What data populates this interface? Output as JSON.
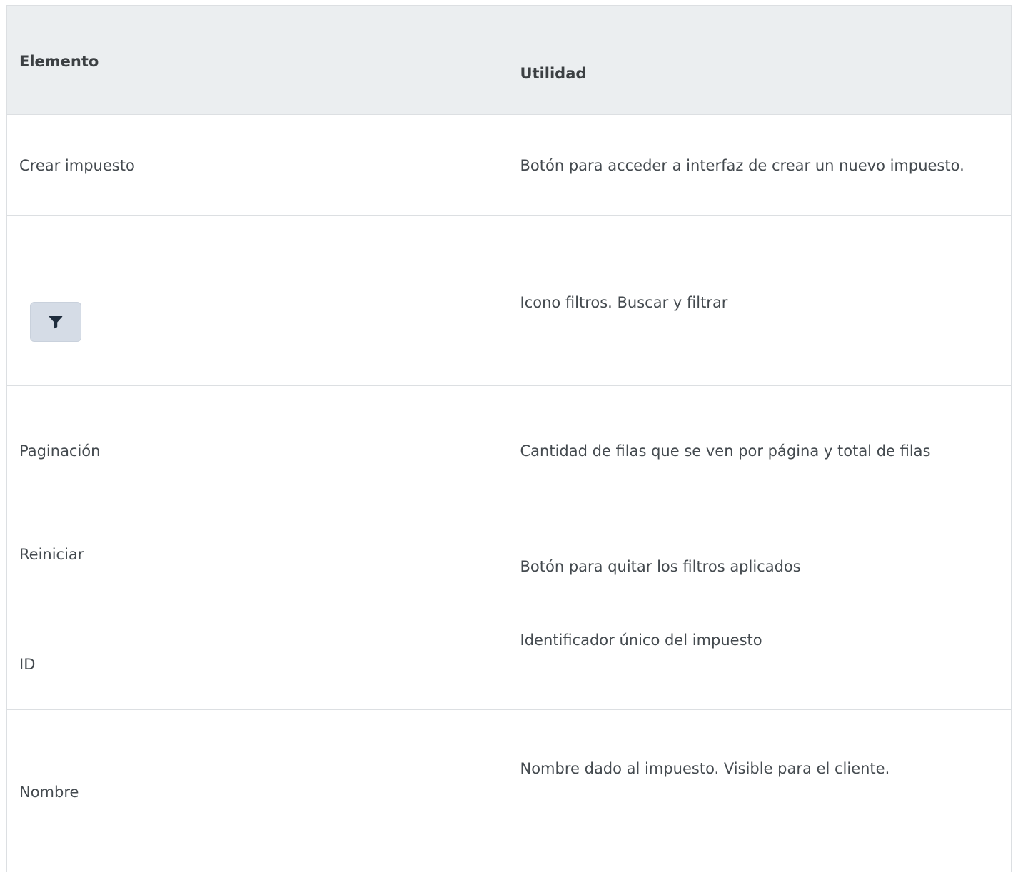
{
  "table": {
    "headers": {
      "element": "Elemento",
      "utility": "Utilidad"
    },
    "rows": [
      {
        "element": "Crear impuesto",
        "utility": "Botón para acceder a interfaz de crear un nuevo impuesto."
      },
      {
        "element": "",
        "element_icon": "filter-icon",
        "utility": "Icono filtros. Buscar y filtrar"
      },
      {
        "element": "Paginación",
        "utility": "Cantidad de filas que se ven por página y total de filas"
      },
      {
        "element": "Reiniciar",
        "utility": "Botón para quitar los filtros aplicados"
      },
      {
        "element": "ID",
        "utility": "Identificador único del impuesto"
      },
      {
        "element": "Nombre",
        "utility": "Nombre dado al impuesto. Visible para el cliente."
      }
    ]
  },
  "colors": {
    "header_background": "#ebeef0",
    "border": "#dcdfe2",
    "text": "#444a4f",
    "filter_button_background": "#d5dce6",
    "filter_icon": "#1f2d3d"
  }
}
